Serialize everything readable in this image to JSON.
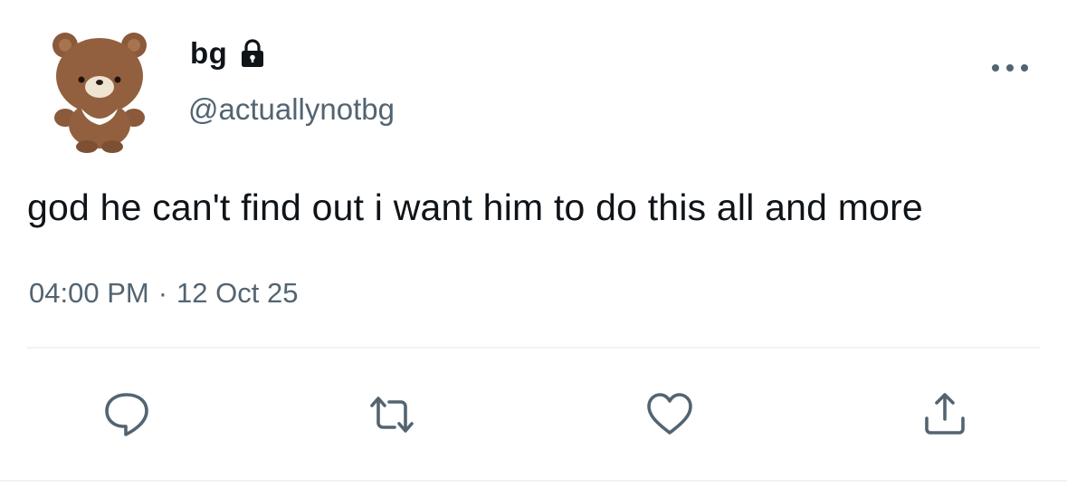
{
  "tweet": {
    "display_name": "bg",
    "handle": "@actuallynotbg",
    "text": "god he can't find out i want him to do this all and more",
    "time": "04:00 PM",
    "separator": "·",
    "date": "12 Oct 25"
  },
  "icons": {
    "avatar": "teddy-bear-avatar",
    "lock": "lock-icon",
    "more": "more-icon",
    "reply": "reply-icon",
    "retweet": "retweet-icon",
    "like": "heart-icon",
    "share": "share-icon"
  },
  "colors": {
    "text_primary": "#0f1419",
    "text_secondary": "#536471",
    "divider": "#eff3f4"
  }
}
